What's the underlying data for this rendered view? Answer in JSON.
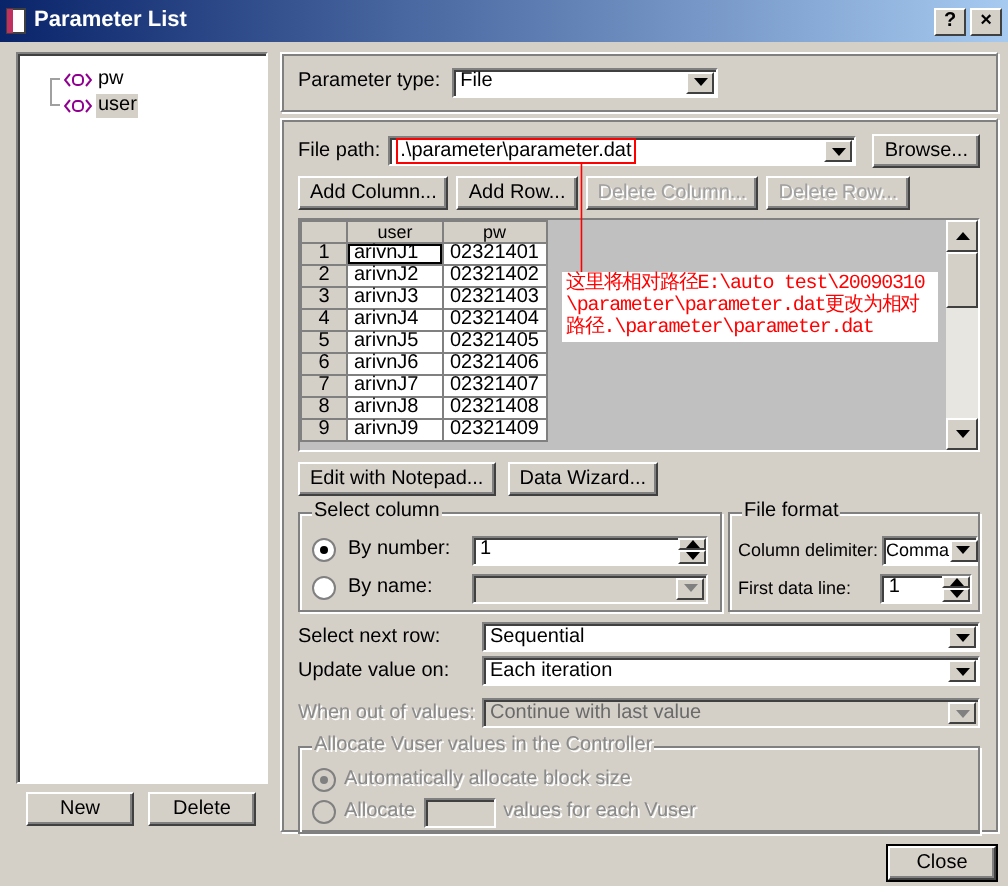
{
  "window": {
    "title": "Parameter List",
    "buttons": [
      "?",
      "×"
    ]
  },
  "tree": [
    {
      "label": "pw",
      "selected": false
    },
    {
      "label": "user",
      "selected": true
    }
  ],
  "left_buttons": [
    "New",
    "Delete"
  ],
  "parameter_type": {
    "label": "Parameter type:",
    "value": "File"
  },
  "file_path": {
    "label": "File path:",
    "value": ".\\parameter\\parameter.dat",
    "button": "Browse..."
  },
  "grid_buttons": [
    {
      "label": "Add Column...",
      "disabled": false
    },
    {
      "label": "Add Row...",
      "disabled": false
    },
    {
      "label": "Delete Column...",
      "disabled": true
    },
    {
      "label": "Delete Row...",
      "disabled": true
    }
  ],
  "table": {
    "columns": [
      "user",
      "pw"
    ],
    "rows": [
      {
        "number": "1",
        "cells": [
          "arivnJ1",
          "02321401"
        ],
        "selected": true
      },
      {
        "number": "2",
        "cells": [
          "arivnJ2",
          "02321402"
        ],
        "selected": false
      },
      {
        "number": "3",
        "cells": [
          "arivnJ3",
          "02321403"
        ],
        "selected": false
      },
      {
        "number": "4",
        "cells": [
          "arivnJ4",
          "02321404"
        ],
        "selected": false
      },
      {
        "number": "5",
        "cells": [
          "arivnJ5",
          "02321405"
        ],
        "selected": false
      },
      {
        "number": "6",
        "cells": [
          "arivnJ6",
          "02321406"
        ],
        "selected": false
      },
      {
        "number": "7",
        "cells": [
          "arivnJ7",
          "02321407"
        ],
        "selected": false
      },
      {
        "number": "8",
        "cells": [
          "arivnJ8",
          "02321408"
        ],
        "selected": false
      },
      {
        "number": "9",
        "cells": [
          "arivnJ9",
          "02321409"
        ],
        "selected": false
      }
    ]
  },
  "annotation": "这里将相对路径E:\\auto test\\20090310\\parameter\\parameter.dat更改为相对路径.\\parameter\\parameter.dat",
  "edit_buttons": [
    "Edit with Notepad...",
    "Data Wizard..."
  ],
  "select_column": {
    "title": "Select column",
    "options": [
      {
        "label": "By number:",
        "selected": true,
        "value": "1"
      },
      {
        "label": "By name:",
        "selected": false
      }
    ]
  },
  "file_format": {
    "title": "File format",
    "delimiter_label": "Column delimiter:",
    "delimiter": "Comma",
    "first_line_label": "First data line:",
    "first_line": "1"
  },
  "settings": [
    {
      "label": "Select next row:",
      "value": "Sequential",
      "disabled": false
    },
    {
      "label": "Update value on:",
      "value": "Each iteration",
      "disabled": false
    },
    {
      "label": "When out of values:",
      "value": "Continue with last value",
      "disabled": true
    }
  ],
  "allocate": {
    "title": "Allocate Vuser values in the Controller",
    "disabled": true,
    "options": [
      {
        "label": "Automatically allocate block size",
        "selected": true
      },
      {
        "label": "Allocate",
        "suffix": "values for each Vuser",
        "selected": false
      }
    ]
  },
  "close": "Close"
}
